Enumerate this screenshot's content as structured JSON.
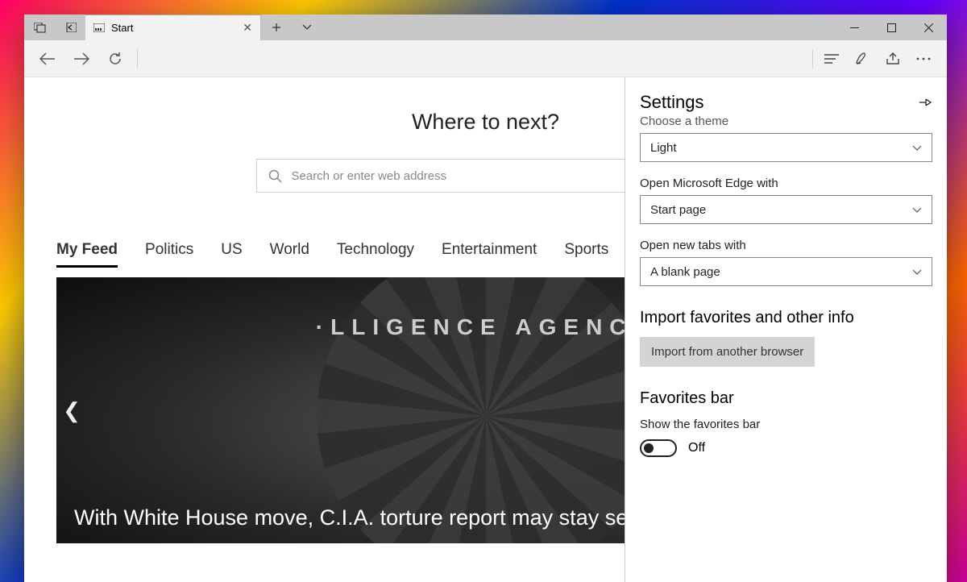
{
  "tab": {
    "label": "Start"
  },
  "page": {
    "prompt": "Where to next?",
    "search_placeholder": "Search or enter web address",
    "feed_tabs": [
      "My Feed",
      "Politics",
      "US",
      "World",
      "Technology",
      "Entertainment",
      "Sports"
    ],
    "hero_seal_text": "·LLIGENCE  AGENCY",
    "hero_headline": "With White House move, C.I.A. torture report may stay secret"
  },
  "settings": {
    "title": "Settings",
    "theme_label": "Choose a theme",
    "theme_value": "Light",
    "open_with_label": "Open Microsoft Edge with",
    "open_with_value": "Start page",
    "new_tabs_label": "Open new tabs with",
    "new_tabs_value": "A blank page",
    "import_header": "Import favorites and other info",
    "import_button": "Import from another browser",
    "favbar_header": "Favorites bar",
    "favbar_toggle_label": "Show the favorites bar",
    "favbar_toggle_state": "Off"
  }
}
